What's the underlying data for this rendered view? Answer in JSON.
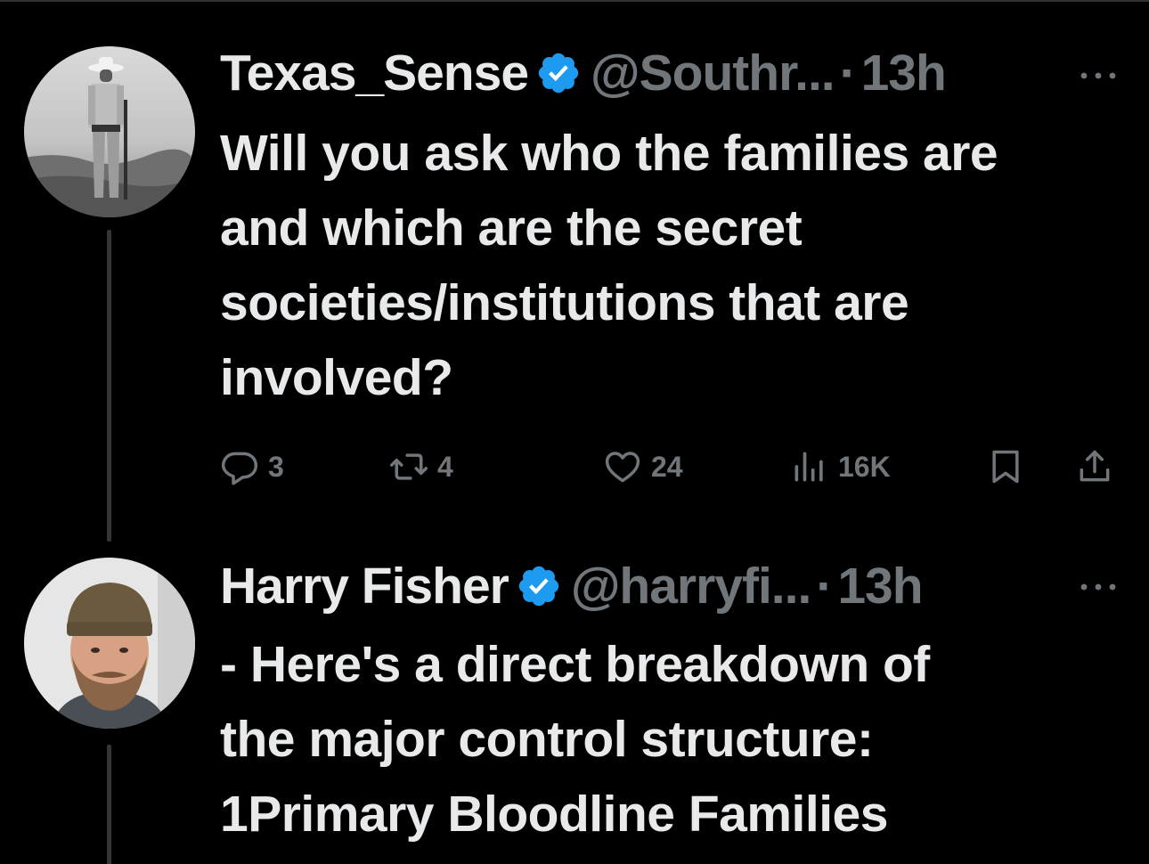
{
  "thread": [
    {
      "display_name": "Texas_Sense",
      "handle": "@Southr...",
      "separator": "·",
      "time": "13h",
      "verified": true,
      "avatar_icon": "cowboy-avatar-icon",
      "text_lines": [
        "Will you ask who the families are",
        "and which are the secret",
        "societies/institutions that are",
        "involved?"
      ],
      "actions": {
        "replies": "3",
        "reposts": "4",
        "likes": "24",
        "views": "16K"
      }
    },
    {
      "display_name": "Harry Fisher",
      "handle": "@harryfi...",
      "separator": "·",
      "time": "13h",
      "verified": true,
      "avatar_icon": "bearded-man-avatar-icon",
      "text_lines": [
        "- Here's a direct breakdown of",
        "the major control structure:",
        "1Primary Bloodline Families"
      ]
    }
  ],
  "colors": {
    "background": "#000000",
    "text": "#e7e9ea",
    "secondary": "#71767b",
    "verified_badge": "#1d9bf0",
    "thread_line": "#333639"
  }
}
